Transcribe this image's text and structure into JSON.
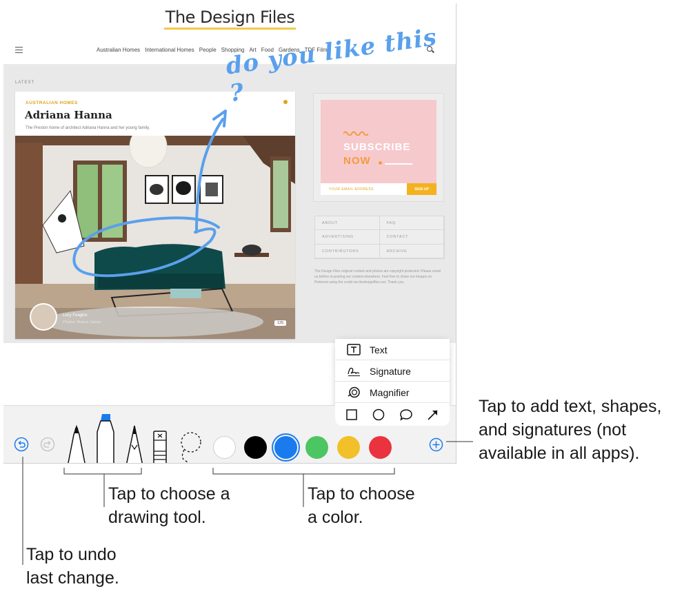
{
  "site": {
    "logo": "The Design Files",
    "nav": [
      "Australian Homes",
      "International Homes",
      "People",
      "Shopping",
      "Art",
      "Food",
      "Gardens",
      "TDF Films"
    ],
    "latest_label": "LATEST",
    "feature": {
      "category": "AUSTRALIAN HOMES",
      "title": "Adriana Hanna",
      "excerpt": "The Preston home of architect Adriana Hanna and her young family.",
      "author_name": "Lucy Feagins",
      "author_role": "Photos: Sharyn Cairns",
      "photo_count": "125"
    },
    "ad": {
      "line1": "SUBSCRIBE",
      "line2": "NOW",
      "email_placeholder": "YOUR EMAIL ADDRESS",
      "signup": "SIGN UP"
    },
    "links": [
      "ABOUT",
      "FAQ",
      "ADVERTISING",
      "CONTACT",
      "CONTRIBUTORS",
      "ARCHIVE"
    ],
    "copyright": "The Design Files original content and photos are copyright protected. Please email us before re-posting our content elsewhere. Feel free to share our images on Pinterest using the credit via thedesignfiles.net. Thank you."
  },
  "markup": {
    "handwriting": "do you like this ?",
    "ink_color": "#5aa0ec"
  },
  "popover": {
    "rows": [
      {
        "icon": "text-box-icon",
        "label": "Text"
      },
      {
        "icon": "signature-icon",
        "label": "Signature"
      },
      {
        "icon": "magnifier-icon",
        "label": "Magnifier"
      }
    ],
    "shapes": [
      "square-icon",
      "circle-icon",
      "speech-bubble-icon",
      "arrow-icon"
    ]
  },
  "toolbar": {
    "tools": [
      "undo-icon",
      "redo-icon",
      "pen-icon",
      "marker-icon",
      "pencil-icon",
      "eraser-icon",
      "lasso-icon",
      "add-icon"
    ],
    "colors": {
      "white": "#ffffff",
      "black": "#000000",
      "blue": "#1a7bef",
      "green": "#4cc563",
      "yellow": "#f2c029",
      "red": "#e9343f"
    },
    "selected_color": "blue"
  },
  "callouts": {
    "add": [
      "Tap to add text, shapes,",
      "and signatures (not",
      "available in all apps)."
    ],
    "tool": [
      "Tap to choose a",
      "drawing tool."
    ],
    "color": [
      "Tap to choose",
      "a color."
    ],
    "undo": [
      "Tap to undo",
      "last change."
    ]
  }
}
